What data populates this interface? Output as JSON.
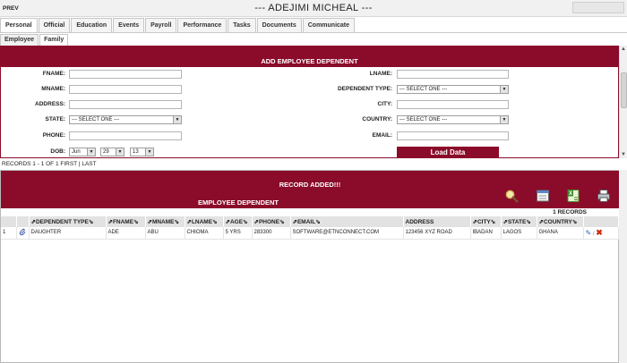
{
  "header": {
    "prev_label": "PREV",
    "title": "--- ADEJIMI MICHEAL ---"
  },
  "tabs": [
    "Personal",
    "Official",
    "Education",
    "Events",
    "Payroll",
    "Performance",
    "Tasks",
    "Documents",
    "Communicate"
  ],
  "subtabs": [
    "Employee",
    "Family"
  ],
  "form": {
    "title": "ADD EMPLOYEE DEPENDENT",
    "fname_label": "FNAME:",
    "mname_label": "MNAME:",
    "address_label": "ADDRESS:",
    "state_label": "STATE:",
    "phone_label": "PHONE:",
    "dob_label": "DOB:",
    "lname_label": "LNAME:",
    "dependent_type_label": "DEPENDENT TYPE:",
    "city_label": "CITY:",
    "country_label": "COUNTRY:",
    "email_label": "EMAIL:",
    "select_one": "--- SELECT ONE ---",
    "dob_month": "Jun",
    "dob_day": "29",
    "dob_year": "13",
    "load_button": "Load Data"
  },
  "records_nav": "RECORDS 1 - 1 OF 1 FIRST | LAST",
  "results": {
    "added_message": "RECORD ADDED!!!",
    "title": "EMPLOYEE DEPENDENT",
    "count": "1 RECORDS",
    "columns": [
      "DEPENDENT TYPE",
      "FNAME",
      "MNAME",
      "LNAME",
      "AGE",
      "PHONE",
      "EMAIL",
      "ADDRESS",
      "CITY",
      "STATE",
      "COUNTRY"
    ],
    "row": {
      "num": "1",
      "dependent_type": "DAUGHTER",
      "fname": "ADE",
      "mname": "ABU",
      "lname": "CHIOMA",
      "age": "5 YRS",
      "phone": "283300",
      "email": "SOFTWARE@ETNCONNECT.COM",
      "address": "123456 XYZ ROAD",
      "city": "IBADAN",
      "state": "LAGOS",
      "country": "GHANA"
    },
    "row_separator": "/"
  },
  "colors": {
    "accent": "#8b0b2a",
    "header_bg": "#f1f1f1",
    "table_header": "#e2e2e2"
  },
  "icons": [
    "search-icon",
    "edit-form-icon",
    "excel-export-icon",
    "print-icon",
    "attach-icon",
    "edit-icon",
    "delete-icon"
  ]
}
